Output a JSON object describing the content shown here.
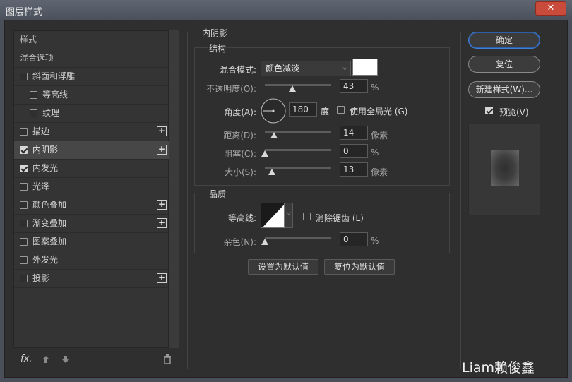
{
  "window": {
    "title": "图层样式",
    "close_label": "✕"
  },
  "styles_list": {
    "header": "样式",
    "blend_options": "混合选项",
    "items": [
      {
        "label": "斜面和浮雕",
        "checked": false,
        "plus": false
      },
      {
        "label": "等高线",
        "checked": false,
        "plus": false
      },
      {
        "label": "纹理",
        "checked": false,
        "plus": false
      },
      {
        "label": "描边",
        "checked": false,
        "plus": true
      },
      {
        "label": "内阴影",
        "checked": true,
        "plus": true,
        "selected": true
      },
      {
        "label": "内发光",
        "checked": true,
        "plus": false
      },
      {
        "label": "光泽",
        "checked": false,
        "plus": false
      },
      {
        "label": "颜色叠加",
        "checked": false,
        "plus": true
      },
      {
        "label": "渐变叠加",
        "checked": false,
        "plus": true
      },
      {
        "label": "图案叠加",
        "checked": false,
        "plus": false
      },
      {
        "label": "外发光",
        "checked": false,
        "plus": false
      },
      {
        "label": "投影",
        "checked": false,
        "plus": true
      }
    ],
    "fx_label": "fx."
  },
  "inner_shadow": {
    "title": "内阴影",
    "structure": {
      "title": "结构",
      "blend_mode_label": "混合模式:",
      "blend_mode_value": "颜色减淡",
      "opacity_label": "不透明度(O):",
      "opacity_value": "43",
      "opacity_unit": "%",
      "angle_label": "角度(A):",
      "angle_value": "180",
      "angle_unit": "度",
      "global_light_label": "使用全局光 (G)",
      "distance_label": "距离(D):",
      "distance_value": "14",
      "distance_unit": "像素",
      "choke_label": "阻塞(C):",
      "choke_value": "0",
      "choke_unit": "%",
      "size_label": "大小(S):",
      "size_value": "13",
      "size_unit": "像素"
    },
    "quality": {
      "title": "品质",
      "contour_label": "等高线:",
      "anti_alias_label": "消除锯齿 (L)",
      "noise_label": "杂色(N):",
      "noise_value": "0",
      "noise_unit": "%"
    },
    "set_default_label": "设置为默认值",
    "reset_default_label": "复位为默认值"
  },
  "actions": {
    "ok_label": "确定",
    "reset_label": "复位",
    "new_style_label": "新建样式(W)...",
    "preview_label": "预览(V)"
  },
  "colors": {
    "shadow_color": "#ffffff",
    "primary_border": "#3f7fd8"
  },
  "watermark": "Liam赖俊鑫"
}
